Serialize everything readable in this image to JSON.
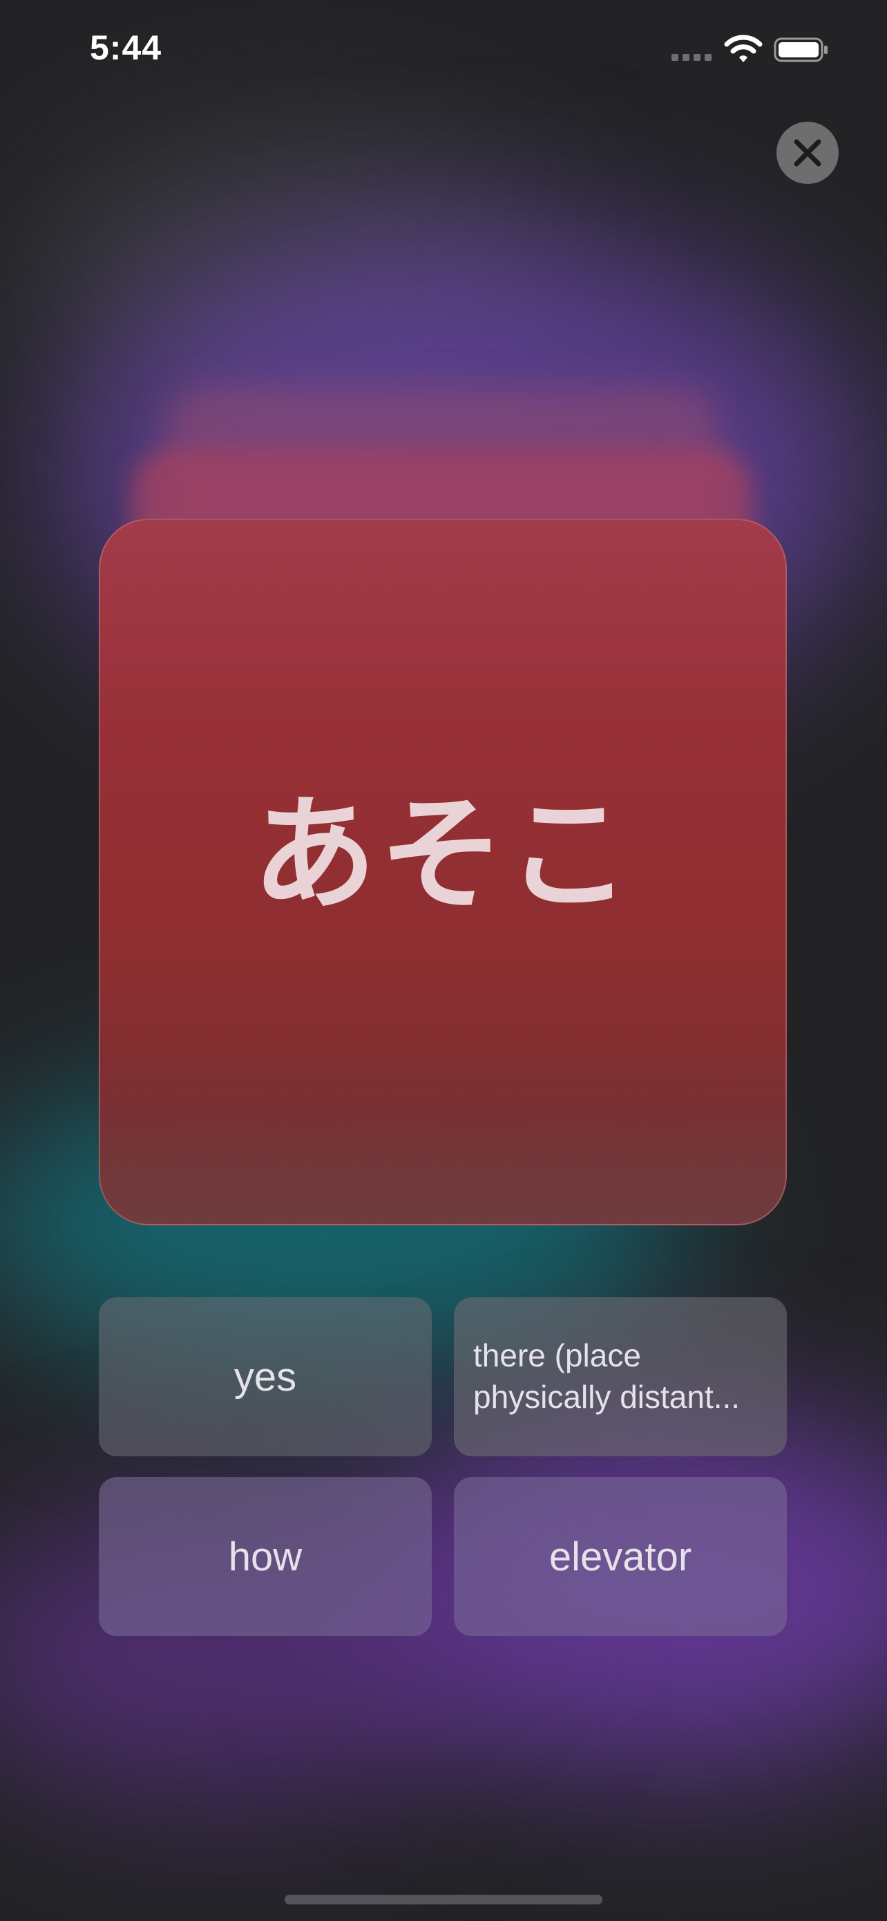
{
  "status_bar": {
    "time": "5:44"
  },
  "card": {
    "word": "あそこ"
  },
  "answers": [
    {
      "label": "yes"
    },
    {
      "label": "there (place physically distant..."
    },
    {
      "label": "how"
    },
    {
      "label": "elevator"
    }
  ],
  "icons": {
    "close": "close-icon",
    "wifi": "wifi-icon",
    "battery": "battery-icon",
    "signal": "signal-icon"
  },
  "colors": {
    "card": "#973037",
    "card_text": "#ead3d6",
    "close_button": "#6e6e6e",
    "answer_text": "#e6e2ea"
  }
}
